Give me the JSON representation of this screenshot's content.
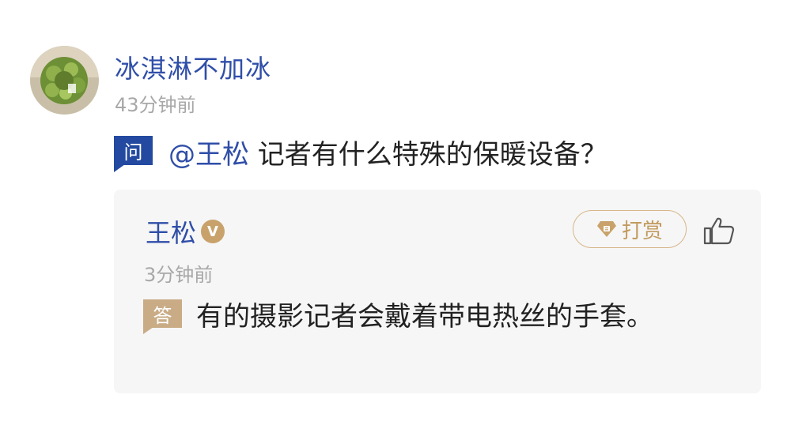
{
  "question_post": {
    "asker_name": "冰淇淋不加冰",
    "time": "43分钟前",
    "badge": "问",
    "mention": "@王松",
    "question_text": " 记者有什么特殊的保暖设备？"
  },
  "answer_post": {
    "answerer_name": "王松",
    "verified_badge": "V",
    "tip_label": "打赏",
    "time": "3分钟前",
    "badge": "答",
    "answer_text": "有的摄影记者会戴着带电热丝的手套。"
  },
  "icons": {
    "avatar": "plant-wreath-avatar",
    "tip": "gem-icon",
    "like": "thumbs-up-icon"
  },
  "colors": {
    "link_blue": "#2f4ea8",
    "question_badge": "#234aa0",
    "answer_badge": "#c9ac86",
    "gold": "#c29a5f",
    "card_bg": "#f6f6f6"
  }
}
